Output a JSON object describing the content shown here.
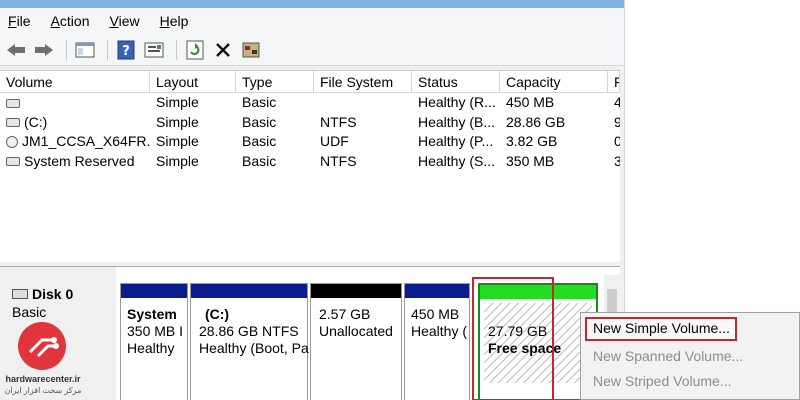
{
  "menu": [
    {
      "label": "File",
      "key": "F",
      "rest": "ile"
    },
    {
      "label": "Action",
      "key": "A",
      "rest": "ction"
    },
    {
      "label": "View",
      "key": "V",
      "rest": "iew"
    },
    {
      "label": "Help",
      "key": "H",
      "rest": "elp"
    }
  ],
  "toolbar": {
    "back_icon": "back-arrow-icon",
    "forward_icon": "forward-arrow-icon",
    "console_icon": "console-tree-icon",
    "help_icon": "help-icon",
    "properties_icon": "properties-icon",
    "refresh_icon": "refresh-icon",
    "delete_icon": "delete-x-icon",
    "settings_icon": "settings-icon"
  },
  "columns": [
    "Volume",
    "Layout",
    "Type",
    "File System",
    "Status",
    "Capacity",
    "F"
  ],
  "volumes": [
    {
      "volume": "",
      "layout": "Simple",
      "type": "Basic",
      "fs": "",
      "status": "Healthy (R...",
      "capacity": "450 MB",
      "free": "4"
    },
    {
      "volume": "(C:)",
      "layout": "Simple",
      "type": "Basic",
      "fs": "NTFS",
      "status": "Healthy (B...",
      "capacity": "28.86 GB",
      "free": "9"
    },
    {
      "volume": "JM1_CCSA_X64FR...",
      "layout": "Simple",
      "type": "Basic",
      "fs": "UDF",
      "status": "Healthy (P...",
      "capacity": "3.82 GB",
      "free": "0"
    },
    {
      "volume": "System Reserved",
      "layout": "Simple",
      "type": "Basic",
      "fs": "NTFS",
      "status": "Healthy (S...",
      "capacity": "350 MB",
      "free": "3"
    }
  ],
  "disk": {
    "name": "Disk 0",
    "type": "Basic"
  },
  "partitions": [
    {
      "name": "System",
      "size": "350 MB I",
      "status": "Healthy"
    },
    {
      "name": "(C:)",
      "size": "28.86 GB NTFS",
      "status": "Healthy (Boot, Pa"
    },
    {
      "name": "",
      "size": "2.57 GB",
      "status": "Unallocated"
    },
    {
      "name": "",
      "size": "450 MB",
      "status": "Healthy ("
    },
    {
      "name": "",
      "size": "27.79 GB",
      "status": "Free space"
    }
  ],
  "colors": {
    "primary_bar": "#0b1d8c",
    "unallocated_bar": "#000000",
    "free_bar": "#22dd22",
    "highlight": "#c1272d"
  },
  "context_menu": {
    "items": [
      "New Simple Volume...",
      "New Spanned Volume...",
      "New Striped Volume..."
    ]
  },
  "logo": {
    "text_en": "hardwarecenter.ir",
    "text_fa": "مرکز سخت افزار ایران"
  }
}
